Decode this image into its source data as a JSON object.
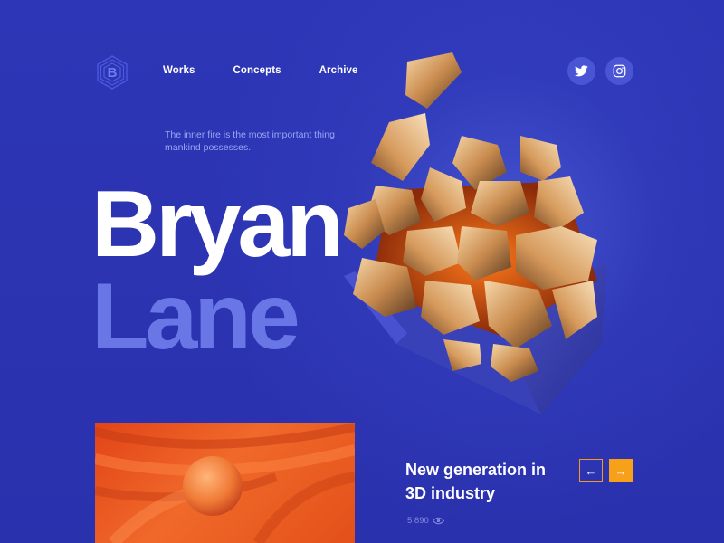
{
  "brand": {
    "logo_letter": "B"
  },
  "nav": {
    "items": [
      {
        "label": "Works"
      },
      {
        "label": "Concepts"
      },
      {
        "label": "Archive"
      }
    ]
  },
  "social": {
    "icons": [
      "twitter-icon",
      "instagram-icon"
    ]
  },
  "hero": {
    "tagline": "The inner fire is the most important thing mankind possesses.",
    "first_name": "Bryan",
    "last_name": "Lane"
  },
  "feature": {
    "headline_line1": "New generation in",
    "headline_line2": "3D industry",
    "views": "5 890",
    "prev_label": "←",
    "next_label": "→"
  },
  "colors": {
    "background": "#2b33b3",
    "accent": "#f7a11a",
    "last_name": "#6876e6",
    "thumbnail": "#e8501f"
  }
}
